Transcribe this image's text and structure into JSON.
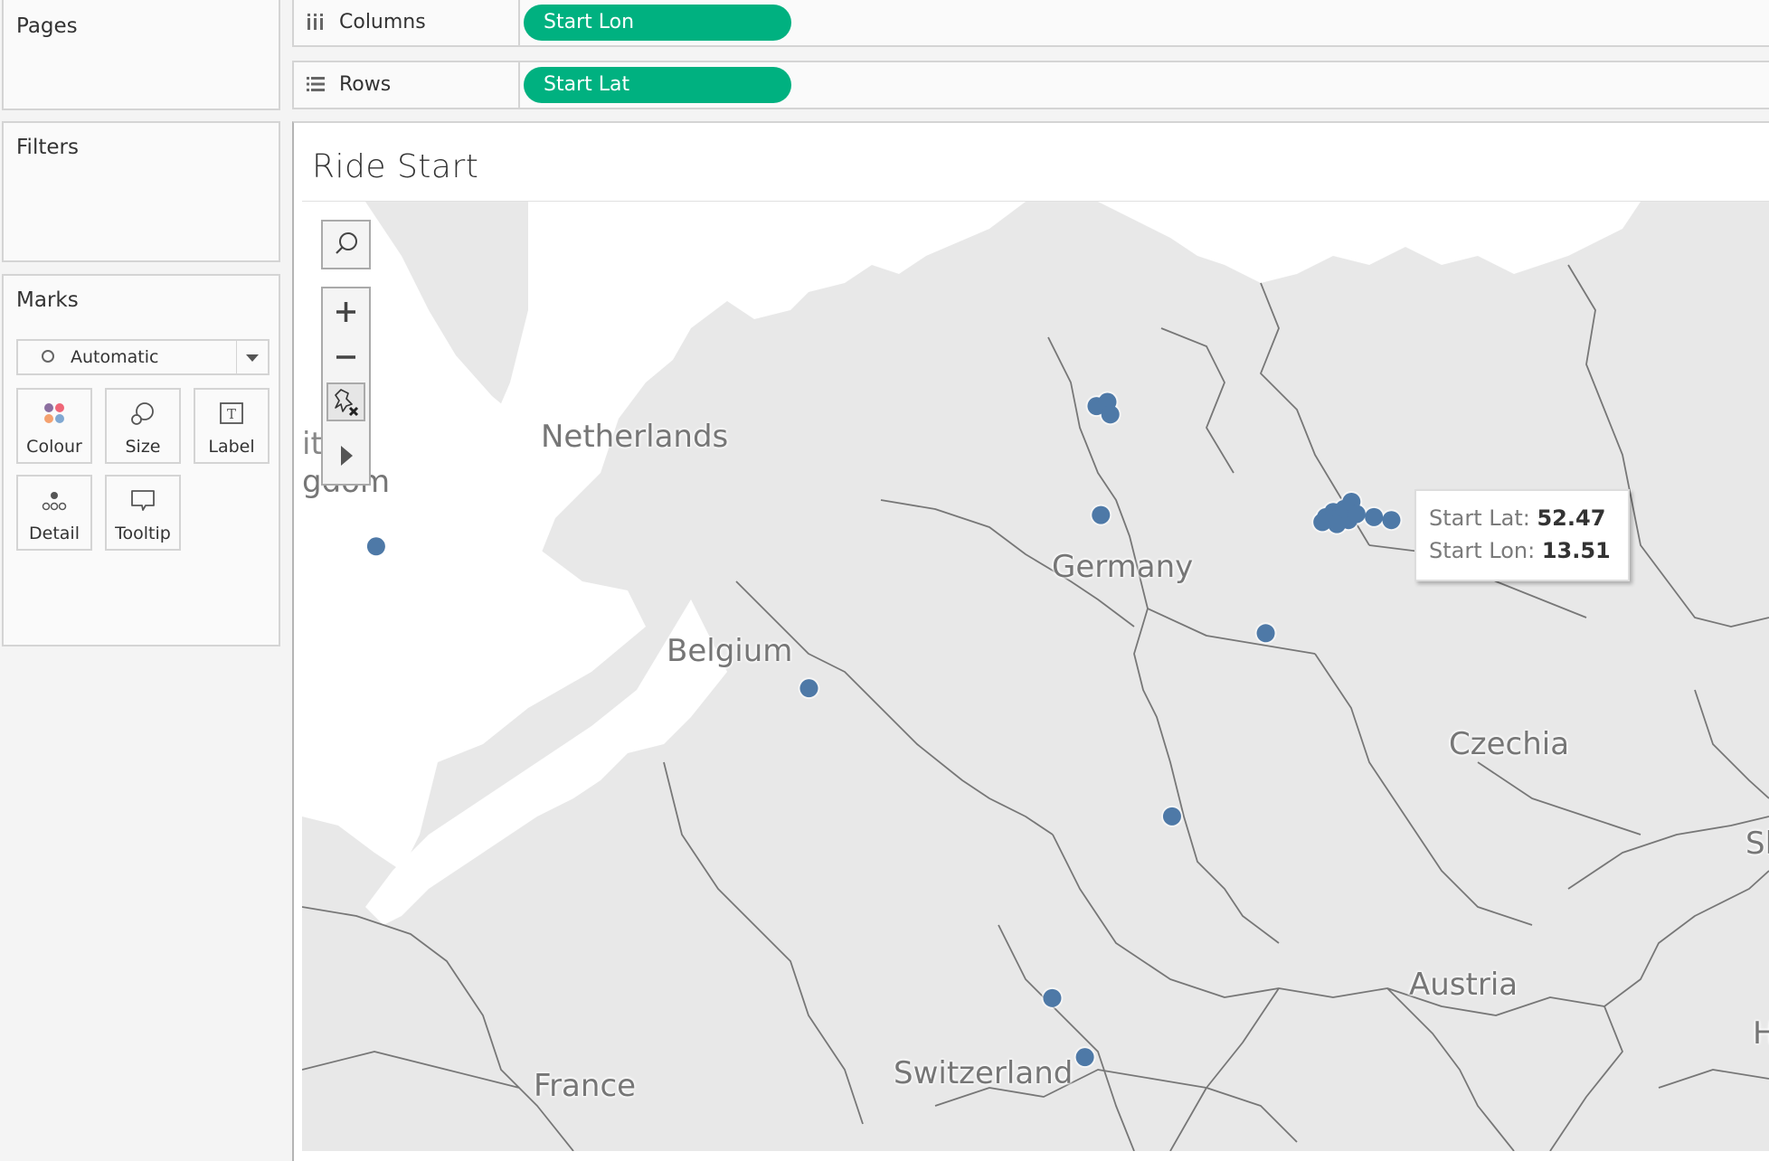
{
  "left_panel": {
    "pages_title": "Pages",
    "filters_title": "Filters",
    "marks": {
      "title": "Marks",
      "mark_type": "Automatic",
      "buttons": [
        {
          "label": "Colour",
          "icon": "colour-icon"
        },
        {
          "label": "Size",
          "icon": "size-icon"
        },
        {
          "label": "Label",
          "icon": "label-icon"
        },
        {
          "label": "Detail",
          "icon": "detail-icon"
        },
        {
          "label": "Tooltip",
          "icon": "tooltip-icon"
        }
      ]
    }
  },
  "shelves": {
    "columns": {
      "label": "Columns",
      "pill": "Start Lon"
    },
    "rows": {
      "label": "Rows",
      "pill": "Start Lat"
    }
  },
  "viz": {
    "title": "Ride Start",
    "country_labels": [
      "Netherlands",
      "Germany",
      "Belgium",
      "Czechia",
      "Austria",
      "France",
      "Switzerland",
      "ited",
      "gdom",
      "Sl",
      "H"
    ],
    "tooltip": {
      "lat_label": "Start Lat:",
      "lat_value": "52.47",
      "lon_label": "Start Lon:",
      "lon_value": "13.51"
    },
    "mark_color": "#4e79a7",
    "pill_color": "#00b180"
  },
  "chart_data": {
    "type": "scatter",
    "title": "Ride Start",
    "xlabel": "Start Lon",
    "ylabel": "Start Lat",
    "points": [
      {
        "lat": 52.21,
        "lon": 0.12
      },
      {
        "lat": 53.58,
        "lon": 10.04
      },
      {
        "lat": 53.62,
        "lon": 10.19
      },
      {
        "lat": 53.5,
        "lon": 10.23
      },
      {
        "lat": 52.52,
        "lon": 10.1
      },
      {
        "lat": 52.47,
        "lon": 13.51
      },
      {
        "lat": 52.52,
        "lon": 13.4
      },
      {
        "lat": 52.55,
        "lon": 13.3
      },
      {
        "lat": 52.5,
        "lon": 13.2
      },
      {
        "lat": 52.45,
        "lon": 13.15
      },
      {
        "lat": 52.43,
        "lon": 13.35
      },
      {
        "lat": 52.58,
        "lon": 13.45
      },
      {
        "lat": 52.65,
        "lon": 13.55
      },
      {
        "lat": 52.53,
        "lon": 13.62
      },
      {
        "lat": 52.5,
        "lon": 13.86
      },
      {
        "lat": 52.47,
        "lon": 14.1
      },
      {
        "lat": 50.78,
        "lon": 6.08
      },
      {
        "lat": 51.34,
        "lon": 12.37
      },
      {
        "lat": 49.45,
        "lon": 11.08
      },
      {
        "lat": 47.5,
        "lon": 9.43
      },
      {
        "lat": 46.85,
        "lon": 9.88
      }
    ],
    "lon_range": [
      -0.9,
      19.3
    ],
    "lat_range": [
      45.8,
      55.5
    ]
  }
}
